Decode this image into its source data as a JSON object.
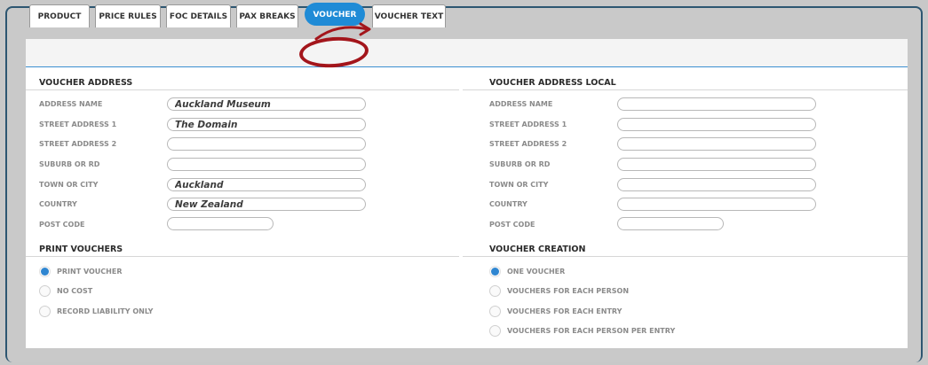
{
  "tabs": [
    {
      "label": "PRODUCT"
    },
    {
      "label": "PRICE RULES"
    },
    {
      "label": "FOC DETAILS"
    },
    {
      "label": "PAX BREAKS"
    },
    {
      "label": "VOUCHER",
      "active": true
    },
    {
      "label": "VOUCHER TEXT"
    }
  ],
  "voucher_address": {
    "title": "VOUCHER ADDRESS",
    "fields": [
      {
        "label": "ADDRESS NAME",
        "value": "Auckland Museum"
      },
      {
        "label": "STREET ADDRESS 1",
        "value": "The Domain"
      },
      {
        "label": "STREET ADDRESS 2",
        "value": ""
      },
      {
        "label": "SUBURB OR RD",
        "value": ""
      },
      {
        "label": "TOWN OR CITY",
        "value": "Auckland"
      },
      {
        "label": "COUNTRY",
        "value": "New Zealand"
      },
      {
        "label": "POST CODE",
        "value": ""
      }
    ]
  },
  "voucher_address_local": {
    "title": "VOUCHER ADDRESS LOCAL",
    "fields": [
      {
        "label": "ADDRESS NAME",
        "value": ""
      },
      {
        "label": "STREET ADDRESS 1",
        "value": ""
      },
      {
        "label": "STREET ADDRESS 2",
        "value": ""
      },
      {
        "label": "SUBURB OR RD",
        "value": ""
      },
      {
        "label": "TOWN OR CITY",
        "value": ""
      },
      {
        "label": "COUNTRY",
        "value": ""
      },
      {
        "label": "POST CODE",
        "value": ""
      }
    ]
  },
  "print_vouchers": {
    "title": "PRINT VOUCHERS",
    "options": [
      {
        "label": "PRINT VOUCHER",
        "selected": true
      },
      {
        "label": "NO COST",
        "selected": false
      },
      {
        "label": "RECORD LIABILITY ONLY",
        "selected": false
      }
    ]
  },
  "voucher_creation": {
    "title": "VOUCHER CREATION",
    "options": [
      {
        "label": "ONE VOUCHER",
        "selected": true
      },
      {
        "label": "VOUCHERS FOR EACH PERSON",
        "selected": false
      },
      {
        "label": "VOUCHERS FOR EACH ENTRY",
        "selected": false
      },
      {
        "label": "VOUCHERS FOR EACH PERSON PER ENTRY",
        "selected": false
      }
    ]
  },
  "colors": {
    "accent": "#1f8bd6",
    "annotation": "#a3151b",
    "frame_border": "#2d5671"
  }
}
